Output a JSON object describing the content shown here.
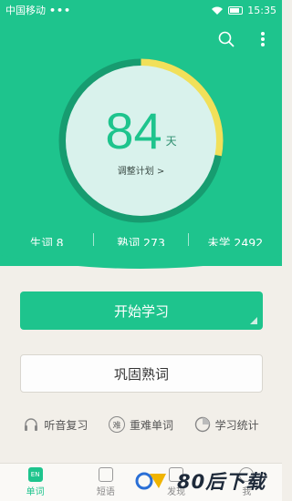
{
  "status_bar": {
    "carrier": "中国移动",
    "dots": "•••",
    "time": "15:35"
  },
  "plan": {
    "days": "84",
    "unit": "天",
    "adjust_label": "调整计划 >",
    "progress": 0.28
  },
  "stats": [
    {
      "label": "生词 8"
    },
    {
      "label": "熟词 273"
    },
    {
      "label": "未学 2492"
    }
  ],
  "buttons": {
    "start": "开始学习",
    "review": "巩固熟词"
  },
  "tools": [
    {
      "label": "听音复习",
      "icon": "headphones-icon"
    },
    {
      "label": "重难单词",
      "icon": "hard-words-icon",
      "glyph": "难"
    },
    {
      "label": "学习统计",
      "icon": "stats-clock-icon"
    }
  ],
  "nav": [
    {
      "label": "单词",
      "badge": "EN"
    },
    {
      "label": "短语"
    },
    {
      "label": "发现"
    },
    {
      "label": "我"
    }
  ],
  "watermark": "80后下载",
  "colors": {
    "accent": "#1ec48d",
    "ring_yellow": "#f1e05a"
  }
}
